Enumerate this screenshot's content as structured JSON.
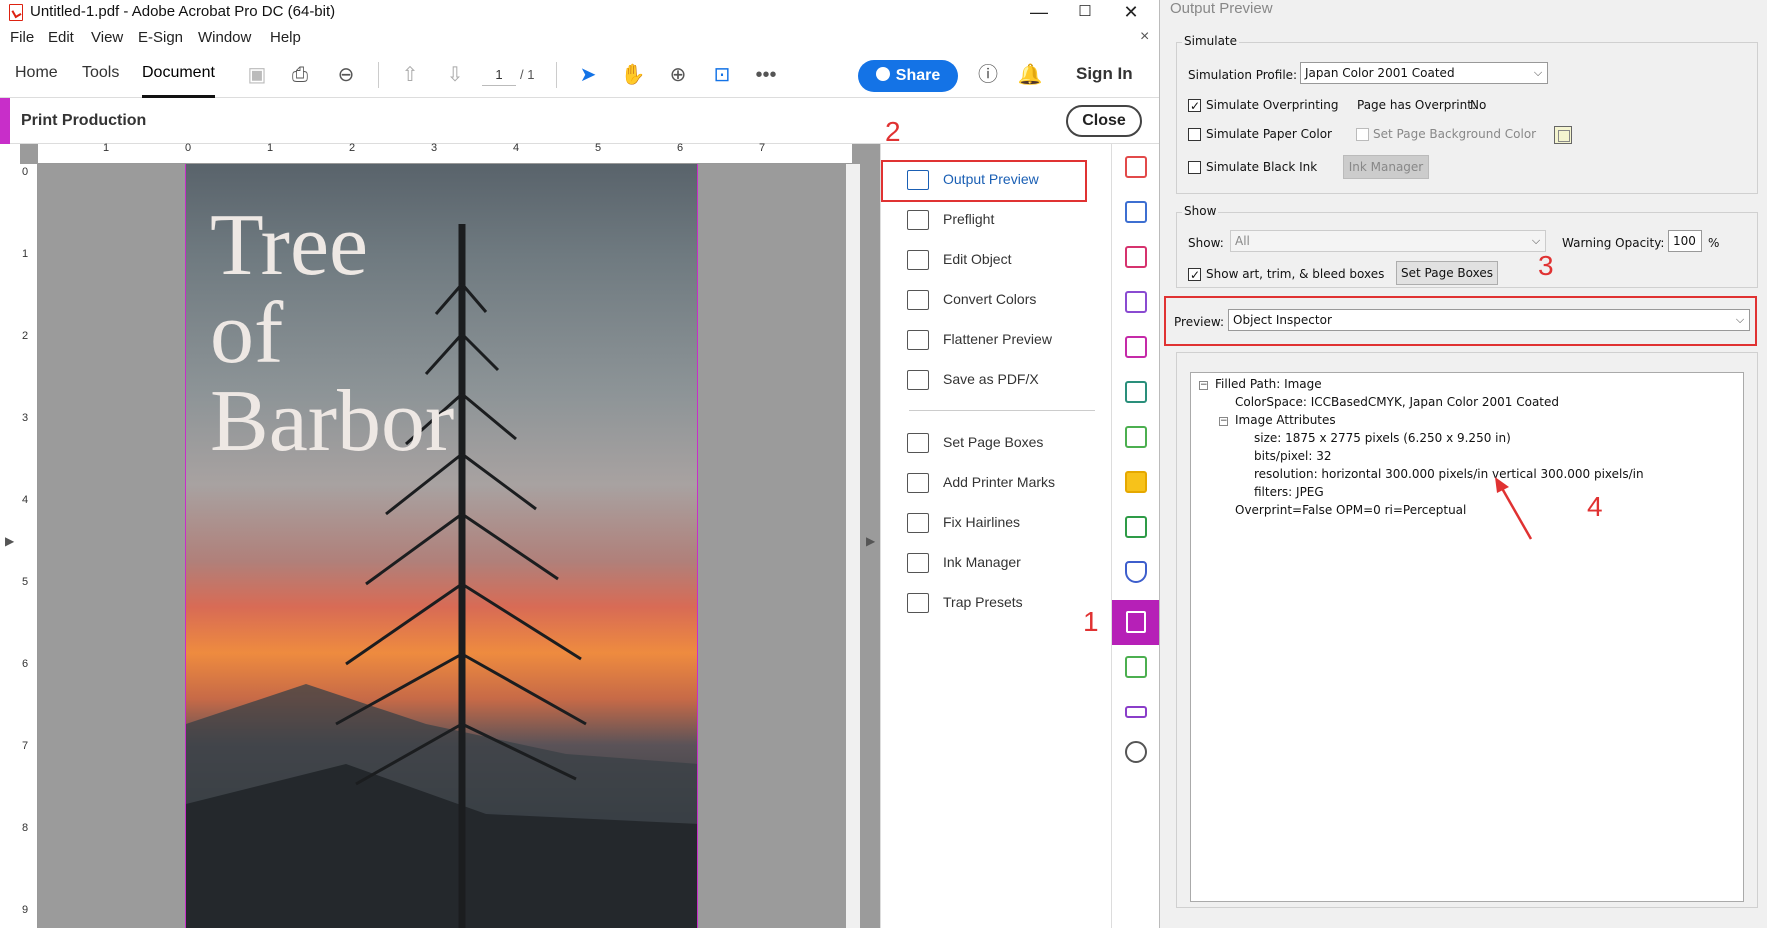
{
  "window": {
    "title": "Untitled-1.pdf - Adobe Acrobat Pro DC (64-bit)",
    "minimize": "—",
    "maximize": "☐",
    "close": "✕"
  },
  "menu": [
    "File",
    "Edit",
    "View",
    "E-Sign",
    "Window",
    "Help"
  ],
  "menu_close": "×",
  "tabs": {
    "home": "Home",
    "tools": "Tools",
    "document": "Document"
  },
  "pagenav": {
    "current": "1",
    "total": "/ 1"
  },
  "share_label": "Share",
  "sign_in": "Sign In",
  "print_production": {
    "title": "Print Production",
    "close": "Close"
  },
  "ruler_top": [
    "1",
    "0",
    "1",
    "2",
    "3",
    "4",
    "5",
    "6",
    "7"
  ],
  "ruler_left": [
    "0",
    "1",
    "2",
    "3",
    "4",
    "5",
    "6",
    "7",
    "8",
    "9"
  ],
  "cover_text": {
    "line1": "Tree",
    "line2": "of",
    "line3": "Barbor"
  },
  "tools_panel": {
    "items": [
      "Output Preview",
      "Preflight",
      "Edit Object",
      "Convert Colors",
      "Flattener Preview",
      "Save as PDF/X",
      "Set Page Boxes",
      "Add Printer Marks",
      "Fix Hairlines",
      "Ink Manager",
      "Trap Presets"
    ]
  },
  "annotations": {
    "a1": "1",
    "a2": "2",
    "a3": "3",
    "a4": "4"
  },
  "output_preview": {
    "title": "Output Preview",
    "simulate": {
      "group": "Simulate",
      "profile_label": "Simulation Profile:",
      "profile_value": "Japan Color 2001 Coated",
      "simulate_overprinting": "Simulate Overprinting",
      "page_has_overprint_label": "Page has Overprint:",
      "page_has_overprint_value": "No",
      "simulate_paper_color": "Simulate Paper Color",
      "set_page_bg": "Set Page Background Color",
      "simulate_black_ink": "Simulate Black Ink",
      "ink_manager": "Ink Manager"
    },
    "show": {
      "group": "Show",
      "show_label": "Show:",
      "show_value": "All",
      "warning_opacity_label": "Warning Opacity:",
      "warning_opacity_value": "100",
      "percent": "%",
      "show_boxes": "Show art, trim, & bleed boxes",
      "set_page_boxes": "Set Page Boxes"
    },
    "preview": {
      "label": "Preview:",
      "value": "Object Inspector"
    },
    "inspector": {
      "filled_path": "Filled Path: Image",
      "colorspace": "ColorSpace: ICCBasedCMYK, Japan Color 2001 Coated",
      "image_attributes": "Image Attributes",
      "size": "size: 1875 x 2775 pixels (6.250 x 9.250 in)",
      "bits": "bits/pixel: 32",
      "resolution": "resolution: horizontal 300.000 pixels/in vertical 300.000 pixels/in",
      "filters": "filters: JPEG",
      "overprint": "Overprint=False OPM=0 ri=Perceptual"
    }
  },
  "colors": {
    "accent": "#c82ec9",
    "share": "#1473e6",
    "annotation": "#e03232",
    "selected_tool": "#1a5fb4"
  }
}
